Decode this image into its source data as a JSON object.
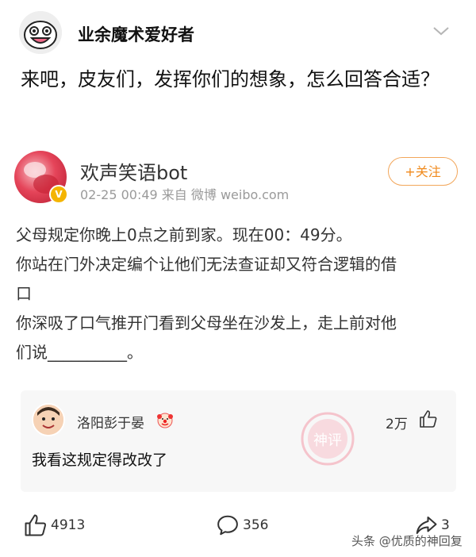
{
  "header": {
    "author_name": "业余魔术爱好者",
    "post_text": "来吧，皮友们，发挥你们的想象，怎么回答合适？"
  },
  "quoted": {
    "bot_name": "欢声笑语bot",
    "meta": "02-25 00:49  来自 微博 weibo.com",
    "follow_label": "+关注",
    "lines": [
      "父母规定你晚上0点之前到家。现在00：49分。",
      "你站在门外决定编个让他们无法查证却又符合逻辑的借",
      "口",
      "你深吸了口气推开门看到父母坐在沙发上，走上前对他",
      "们说__________。"
    ]
  },
  "comment": {
    "name": "洛阳彭于晏",
    "likes": "2万",
    "text": "我看这规定得改改了",
    "stamp_label": "神评"
  },
  "actions": {
    "likes": "4913",
    "comments": "356",
    "shares": "3"
  },
  "watermark": "头条 @优质的神回复",
  "colors": {
    "follow": "#f08a1c",
    "stamp": "#f4b6c0"
  }
}
